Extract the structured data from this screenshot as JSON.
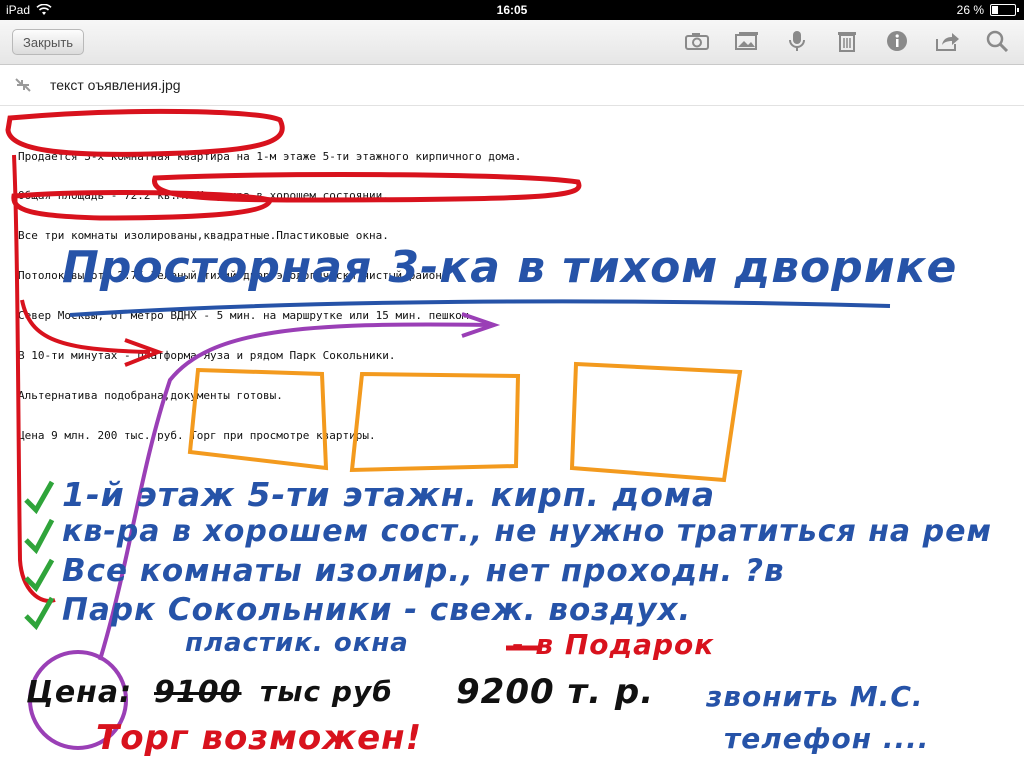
{
  "status_bar": {
    "device": "iPad",
    "time": "16:05",
    "battery": "26 %",
    "battery_level": 0.26
  },
  "toolbar": {
    "close_label": "Закрыть",
    "icons": [
      "camera-icon",
      "photo-icon",
      "microphone-icon",
      "trash-icon",
      "info-icon",
      "share-icon",
      "search-icon"
    ]
  },
  "attachment": {
    "filename": "текст оъявления.jpg"
  },
  "ad_text": {
    "lines": [
      "Продаётся 3-х комнатная квартира на 1-м этаже 5-ти этажного кирпичного дома.",
      "Общая площадь - 72.2 кв.м. Квартира в хорошем состоянии.",
      "Все три комнаты изолированы,квадратные.Пластиковые окна.",
      "Потолок высота 2.75.Зеленый тихий двор экологически чистый район.",
      "Север Москвы, от метро ВДНХ - 5 мин. на маршрутке или 15 мин. пешком.",
      "В 10-ти минутах - платформа Яуза и рядом Парк Сокольники.",
      "Альтернатива подобрана,документы готовы.",
      "Цена 9 млн. 200 тыс. руб. Торг при просмотре квартиры."
    ]
  },
  "handwriting": {
    "headline": "Просторная 3-ка в тихом дворике",
    "checklist": [
      "1-й этаж 5-ти этажн. кирп. дома",
      "кв-ра в хорошем сост., не нужно тратиться на рем",
      "Все комнаты изолир., нет проходн. ?в",
      "Парк Сокольники - свеж. воздух."
    ],
    "windows_note": "пластик. окна",
    "gift_note": "- в Подарок",
    "price_label": "Цена:",
    "price_old": "9100",
    "price_units": "тыс руб",
    "price_new": "9200 т. р.",
    "bargain_note": "Торг возможен!",
    "call_note": "звонить М.С.",
    "phone_note": "телефон ....",
    "colors": {
      "blue": "#2653a8",
      "red": "#d8121d",
      "orange": "#f39a1e",
      "purple": "#9a3fb6",
      "green": "#2fa43a",
      "black": "#111111"
    }
  }
}
